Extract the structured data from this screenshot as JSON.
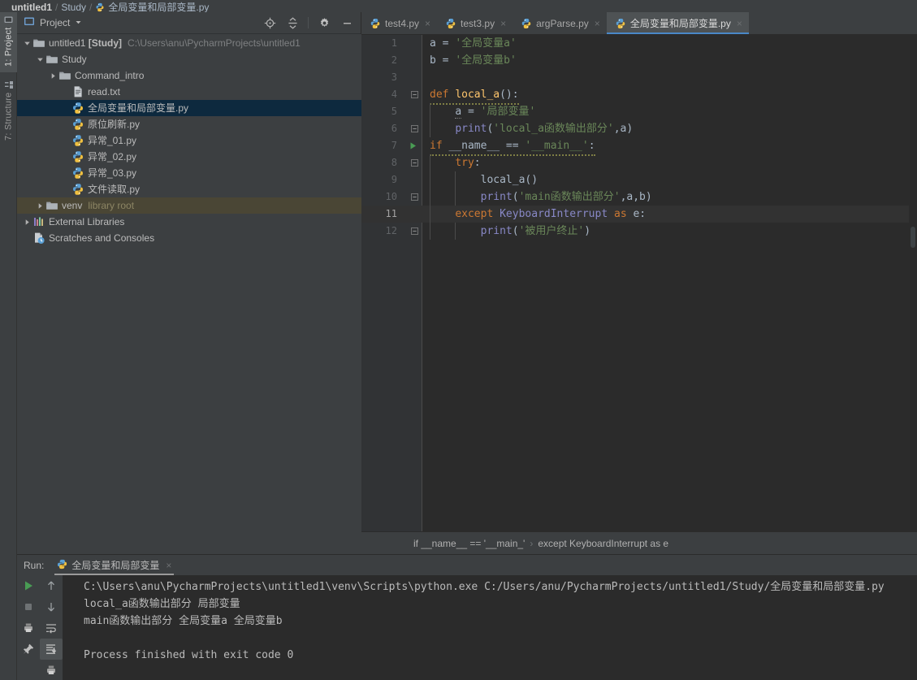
{
  "topbar": {
    "crumbs": [
      "untitled1",
      "Study",
      "全局变量和局部变量.py"
    ],
    "separator": "/"
  },
  "left_rail": {
    "tabs": [
      {
        "label": "1: Project",
        "icon": "project-icon",
        "active": true
      },
      {
        "label": "7: Structure",
        "icon": "structure-icon",
        "active": false
      }
    ]
  },
  "project_panel": {
    "title": "Project",
    "dropdown_icon": "chevron-down-icon",
    "toolbar": [
      {
        "name": "locate-icon",
        "title": "Select Opened File"
      },
      {
        "name": "collapse-all-icon",
        "title": "Collapse All"
      },
      {
        "name": "gear-icon",
        "title": "Settings"
      },
      {
        "name": "minimize-icon",
        "title": "Hide"
      }
    ],
    "tree": [
      {
        "label": "untitled1",
        "bold_label": "[Study]",
        "note": "C:\\Users\\anu\\PycharmProjects\\untitled1",
        "icon": "folder-icon",
        "arrow": "expanded",
        "depth": 0,
        "state": "none"
      },
      {
        "label": "Study",
        "note": "",
        "icon": "folder-icon",
        "arrow": "expanded",
        "depth": 1,
        "state": "none"
      },
      {
        "label": "Command_intro",
        "note": "",
        "icon": "folder-icon",
        "arrow": "collapsed",
        "depth": 2,
        "state": "none"
      },
      {
        "label": "read.txt",
        "note": "",
        "icon": "text-file-icon",
        "arrow": "none",
        "depth": 3,
        "state": "none"
      },
      {
        "label": "全局变量和局部变量.py",
        "note": "",
        "icon": "python-file-icon",
        "arrow": "none",
        "depth": 3,
        "state": "selected"
      },
      {
        "label": "原位刷新.py",
        "note": "",
        "icon": "python-file-icon",
        "arrow": "none",
        "depth": 3,
        "state": "none"
      },
      {
        "label": "异常_01.py",
        "note": "",
        "icon": "python-file-icon",
        "arrow": "none",
        "depth": 3,
        "state": "none"
      },
      {
        "label": "异常_02.py",
        "note": "",
        "icon": "python-file-icon",
        "arrow": "none",
        "depth": 3,
        "state": "none"
      },
      {
        "label": "异常_03.py",
        "note": "",
        "icon": "python-file-icon",
        "arrow": "none",
        "depth": 3,
        "state": "none"
      },
      {
        "label": "文件读取.py",
        "note": "",
        "icon": "python-file-icon",
        "arrow": "none",
        "depth": 3,
        "state": "none"
      },
      {
        "label": "venv",
        "note": "library root",
        "icon": "folder-icon",
        "arrow": "collapsed",
        "depth": 1,
        "state": "hover"
      },
      {
        "label": "External Libraries",
        "note": "",
        "icon": "libraries-icon",
        "arrow": "collapsed",
        "depth": 0,
        "state": "none"
      },
      {
        "label": "Scratches and Consoles",
        "note": "",
        "icon": "scratches-icon",
        "arrow": "none",
        "depth": 0,
        "state": "none"
      }
    ]
  },
  "editor": {
    "tabs": [
      {
        "label": "test4.py",
        "icon": "python-file-icon",
        "active": false,
        "close": "×"
      },
      {
        "label": "test3.py",
        "icon": "python-file-icon",
        "active": false,
        "close": "×"
      },
      {
        "label": "argParse.py",
        "icon": "python-file-icon",
        "active": false,
        "close": "×"
      },
      {
        "label": "全局变量和局部变量.py",
        "icon": "python-file-icon",
        "active": true,
        "close": "×"
      }
    ],
    "caret_line": 11,
    "run_marker_line": 7,
    "lines": [
      {
        "n": "1",
        "fold": "",
        "tokens": [
          {
            "t": "a ",
            "c": "pln"
          },
          {
            "t": "= ",
            "c": "pln"
          },
          {
            "t": "'全局变量a'",
            "c": "str"
          }
        ]
      },
      {
        "n": "2",
        "fold": "",
        "tokens": [
          {
            "t": "b ",
            "c": "pln"
          },
          {
            "t": "= ",
            "c": "pln"
          },
          {
            "t": "'全局变量b'",
            "c": "str"
          }
        ]
      },
      {
        "n": "3",
        "fold": "",
        "tokens": []
      },
      {
        "n": "4",
        "fold": "-",
        "tokens": [
          {
            "t": "def ",
            "c": "kw"
          },
          {
            "t": "local_a",
            "c": "fn"
          },
          {
            "t": "():",
            "c": "pln"
          }
        ]
      },
      {
        "n": "5",
        "fold": "",
        "tokens": [
          {
            "t": "    ",
            "c": "pln"
          },
          {
            "t": "a",
            "c": "localv"
          },
          {
            "t": " = ",
            "c": "pln"
          },
          {
            "t": "'局部变量'",
            "c": "str"
          }
        ]
      },
      {
        "n": "6",
        "fold": "-",
        "tokens": [
          {
            "t": "    ",
            "c": "pln"
          },
          {
            "t": "print",
            "c": "bif"
          },
          {
            "t": "(",
            "c": "pln"
          },
          {
            "t": "'local_a函数输出部分'",
            "c": "str"
          },
          {
            "t": ",a)",
            "c": "pln"
          }
        ]
      },
      {
        "n": "7",
        "fold": "-",
        "tokens": [
          {
            "t": "if ",
            "c": "kw"
          },
          {
            "t": "__name__",
            "c": "pln"
          },
          {
            "t": " == ",
            "c": "pln"
          },
          {
            "t": "'__main__'",
            "c": "str"
          },
          {
            "t": ":",
            "c": "pln"
          }
        ]
      },
      {
        "n": "8",
        "fold": "-",
        "tokens": [
          {
            "t": "    ",
            "c": "pln"
          },
          {
            "t": "try",
            "c": "kw"
          },
          {
            "t": ":",
            "c": "pln"
          }
        ]
      },
      {
        "n": "9",
        "fold": "",
        "tokens": [
          {
            "t": "        ",
            "c": "pln"
          },
          {
            "t": "local_a()",
            "c": "pln"
          }
        ]
      },
      {
        "n": "10",
        "fold": "-",
        "tokens": [
          {
            "t": "        ",
            "c": "pln"
          },
          {
            "t": "print",
            "c": "bif"
          },
          {
            "t": "(",
            "c": "pln"
          },
          {
            "t": "'main函数输出部分'",
            "c": "str"
          },
          {
            "t": ",a,b)",
            "c": "pln"
          }
        ]
      },
      {
        "n": "11",
        "fold": "",
        "tokens": [
          {
            "t": "    ",
            "c": "pln"
          },
          {
            "t": "except ",
            "c": "kw"
          },
          {
            "t": "KeyboardInterrupt",
            "c": "bif"
          },
          {
            "t": " as ",
            "c": "kw"
          },
          {
            "t": "e:",
            "c": "pln"
          }
        ]
      },
      {
        "n": "12",
        "fold": "-",
        "tokens": [
          {
            "t": "        ",
            "c": "pln"
          },
          {
            "t": "print",
            "c": "bif"
          },
          {
            "t": "(",
            "c": "pln"
          },
          {
            "t": "'被用户终止'",
            "c": "str"
          },
          {
            "t": ")",
            "c": "pln"
          }
        ]
      }
    ],
    "breadcrumbs": [
      "if __name__ == '__main_'",
      "except KeyboardInterrupt as e"
    ],
    "breadcrumb_separator": "›"
  },
  "run_panel": {
    "label": "Run:",
    "tab_label": "全局变量和局部变量",
    "tab_icon": "python-file-icon",
    "tab_close": "×",
    "toolbar_left": [
      {
        "name": "rerun-icon",
        "active": false
      },
      {
        "name": "stop-icon",
        "active": false
      },
      {
        "name": "print-icon",
        "active": false
      },
      {
        "name": "pin-icon",
        "active": false
      }
    ],
    "toolbar_right": [
      {
        "name": "up-arrow-icon",
        "active": false
      },
      {
        "name": "down-arrow-icon",
        "active": false
      },
      {
        "name": "soft-wrap-icon",
        "active": false
      },
      {
        "name": "scroll-to-end-icon",
        "active": true
      },
      {
        "name": "print-settings-icon",
        "active": false
      }
    ],
    "console_lines": [
      "C:\\Users\\anu\\PycharmProjects\\untitled1\\venv\\Scripts\\python.exe C:/Users/anu/PycharmProjects/untitled1/Study/全局变量和局部变量.py",
      "local_a函数输出部分 局部变量",
      "main函数输出部分 全局变量a 全局变量b",
      "",
      "Process finished with exit code 0"
    ]
  },
  "colors": {
    "bg_panel": "#3C3F41",
    "bg_editor": "#2B2B2B",
    "accent_tab": "#4A88C7",
    "selection": "#0D293E",
    "hover_olive": "#4A4635",
    "keyword": "#CC7832",
    "string": "#6A8759",
    "function": "#FFC66D",
    "builtin": "#8888C6",
    "text": "#A9B7C6",
    "run_green": "#499C54"
  }
}
